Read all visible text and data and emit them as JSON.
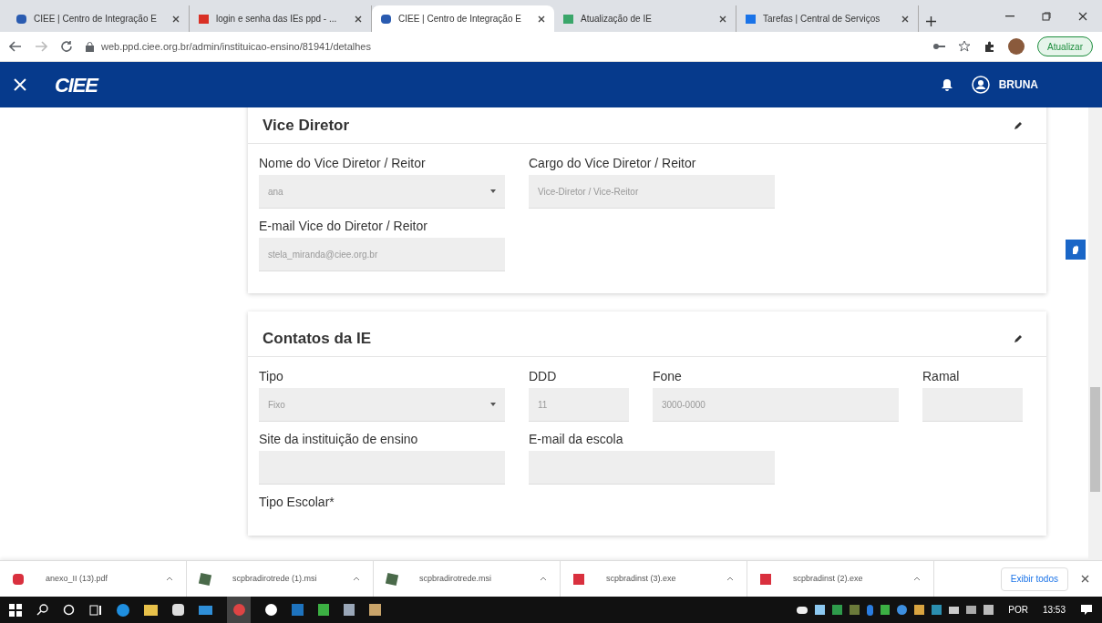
{
  "browser": {
    "tabs": [
      {
        "title": "CIEE | Centro de Integração E",
        "selected": false
      },
      {
        "title": "login e senha das IEs ppd - ...",
        "selected": false
      },
      {
        "title": "CIEE | Centro de Integração E",
        "selected": true
      },
      {
        "title": "Atualização de IE",
        "selected": false
      },
      {
        "title": "Tarefas | Central de Serviços",
        "selected": false
      }
    ],
    "address": "web.ppd.ciee.org.br/admin/instituicao-ensino/81941/detalhes",
    "update_button": "Atualizar"
  },
  "app_header": {
    "logo": "CIEE",
    "user": "BRUNA"
  },
  "sections": [
    {
      "title": "Vice Diretor",
      "rows": [
        [
          {
            "label": "Nome do Vice Diretor / Reitor",
            "value": "ana",
            "kind": "select"
          },
          {
            "label": "Cargo do Vice Diretor / Reitor",
            "value": "Vice-Diretor / Vice-Reitor",
            "kind": "text"
          }
        ],
        [
          {
            "label": "E-mail Vice do Diretor / Reitor",
            "value": "stela_miranda@ciee.org.br",
            "kind": "text"
          }
        ]
      ]
    },
    {
      "title": "Contatos da IE",
      "rows": [
        [
          {
            "label": "Tipo",
            "value": "Fixo",
            "kind": "select"
          },
          {
            "label": "DDD",
            "value": "11",
            "kind": "text"
          },
          {
            "label": "Fone",
            "value": "3000-0000",
            "kind": "text"
          },
          {
            "label": "Ramal",
            "kind": "text"
          }
        ],
        [
          {
            "label": "Site da instituição de ensino",
            "kind": "text"
          },
          {
            "label": "E-mail da escola",
            "kind": "text"
          }
        ],
        [
          {
            "label": "Tipo Escolar*",
            "kind": "label"
          }
        ]
      ]
    }
  ],
  "downloads": [
    {
      "name": "anexo_II (13).pdf"
    },
    {
      "name": "scpbradirotrede (1).msi"
    },
    {
      "name": "scpbradirotrede.msi"
    },
    {
      "name": "scpbradinst (3).exe"
    },
    {
      "name": "scpbradinst (2).exe"
    }
  ],
  "show_all": "Exibir todos",
  "taskbar": {
    "language": "POR",
    "time": "13:53"
  }
}
